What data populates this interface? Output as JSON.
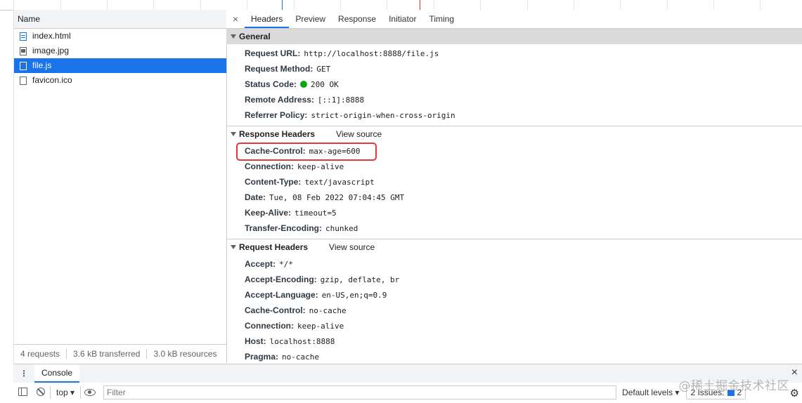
{
  "request_list": {
    "header": "Name",
    "rows": [
      {
        "name": "index.html",
        "icon": "document-icon"
      },
      {
        "name": "image.jpg",
        "icon": "image-icon"
      },
      {
        "name": "file.js",
        "icon": "script-icon",
        "selected": true
      },
      {
        "name": "favicon.ico",
        "icon": "file-icon"
      }
    ],
    "status": {
      "requests": "4 requests",
      "transferred": "3.6 kB transferred",
      "resources": "3.0 kB resources"
    }
  },
  "tabs": {
    "close": "×",
    "items": [
      "Headers",
      "Preview",
      "Response",
      "Initiator",
      "Timing"
    ],
    "active": "Headers"
  },
  "general": {
    "title": "General",
    "fields": [
      {
        "key": "Request URL:",
        "value": "http://localhost:8888/file.js"
      },
      {
        "key": "Request Method:",
        "value": "GET"
      },
      {
        "key": "Status Code:",
        "value": "200 OK"
      },
      {
        "key": "Remote Address:",
        "value": "[::1]:8888"
      },
      {
        "key": "Referrer Policy:",
        "value": "strict-origin-when-cross-origin"
      }
    ]
  },
  "response_headers": {
    "title": "Response Headers",
    "view_source": "View source",
    "fields": [
      {
        "key": "Cache-Control:",
        "value": "max-age=600"
      },
      {
        "key": "Connection:",
        "value": "keep-alive"
      },
      {
        "key": "Content-Type:",
        "value": "text/javascript"
      },
      {
        "key": "Date:",
        "value": "Tue, 08 Feb 2022 07:04:45 GMT"
      },
      {
        "key": "Keep-Alive:",
        "value": "timeout=5"
      },
      {
        "key": "Transfer-Encoding:",
        "value": "chunked"
      }
    ]
  },
  "request_headers": {
    "title": "Request Headers",
    "view_source": "View source",
    "fields": [
      {
        "key": "Accept:",
        "value": "*/*"
      },
      {
        "key": "Accept-Encoding:",
        "value": "gzip, deflate, br"
      },
      {
        "key": "Accept-Language:",
        "value": "en-US,en;q=0.9"
      },
      {
        "key": "Cache-Control:",
        "value": "no-cache"
      },
      {
        "key": "Connection:",
        "value": "keep-alive"
      },
      {
        "key": "Host:",
        "value": "localhost:8888"
      },
      {
        "key": "Pragma:",
        "value": "no-cache"
      }
    ]
  },
  "drawer": {
    "console_tab": "Console",
    "close": "×",
    "context": "top ▾",
    "filter_placeholder": "Filter",
    "levels": "Default levels ▾",
    "issues_label": "2 Issues:",
    "issues_count": "2"
  },
  "watermark": "@稀土掘金技术社区",
  "colors": {
    "selection": "#1a73e8",
    "highlight_box": "#e53935",
    "status_ok": "#0ca40c"
  }
}
